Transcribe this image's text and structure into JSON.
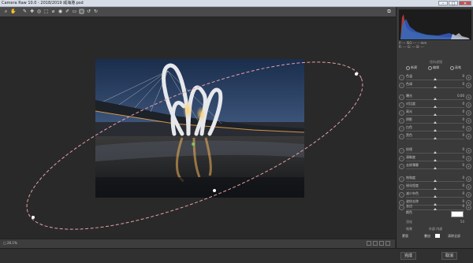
{
  "window": {
    "title": "Camera Raw 10.0 - 2018/2019 威海港.psd",
    "minimize": "–",
    "maximize": "□",
    "close": "✕"
  },
  "toolbar": {
    "tools": [
      "zoom-tool",
      "hand-tool",
      "white-balance-tool",
      "color-sampler-tool",
      "targeted-adjustment-tool",
      "transform-tool",
      "spot-removal-tool",
      "red-eye-tool",
      "adjustment-brush-tool",
      "graduated-filter-tool",
      "radial-filter-tool",
      "rotate-ccw-tool",
      "rotate-cw-tool"
    ],
    "glyphs": [
      "⌕",
      "✋",
      "✎",
      "✚",
      "◎",
      "⬚",
      "⌀",
      "◉",
      "✐",
      "▭",
      "◯",
      "↺",
      "↻"
    ],
    "preview_glyph": "⧉"
  },
  "camera_info": {
    "line1": "f/   ---     ISO ---    -- mm",
    "line2": "R:  ---    G:  ---    B:  ---"
  },
  "mode": {
    "label": "径向滤镜",
    "options": [
      "新建",
      "编辑",
      "画笔"
    ]
  },
  "sliders": [
    {
      "label": "色温",
      "value": "0"
    },
    {
      "label": "色调",
      "value": "0"
    },
    {
      "label": "曝光",
      "value": "0.00"
    },
    {
      "label": "对比度",
      "value": "0"
    },
    {
      "label": "高光",
      "value": "0"
    },
    {
      "label": "阴影",
      "value": "0"
    },
    {
      "label": "白色",
      "value": "0"
    },
    {
      "label": "黑色",
      "value": "0"
    },
    {
      "label": "纹理",
      "value": "0"
    },
    {
      "label": "清晰度",
      "value": "0"
    },
    {
      "label": "去除薄雾",
      "value": "0"
    },
    {
      "label": "饱和度",
      "value": "0"
    },
    {
      "label": "锐化程度",
      "value": "0"
    },
    {
      "label": "减少杂色",
      "value": "0"
    },
    {
      "label": "波纹去除",
      "value": "0"
    },
    {
      "label": "去边",
      "value": "0"
    }
  ],
  "color": {
    "label": "颜色",
    "swatch": "#ffffff"
  },
  "misc": {
    "feather_label": "羽化",
    "feather_value": "50",
    "effect_label": "效果",
    "effect_options": "外部   内部"
  },
  "panel_footer": {
    "mask_label": "蒙版",
    "overlay_label": "叠加",
    "clear_label": "清除全部"
  },
  "bottom": {
    "zoom": "□ 26.1%",
    "mode": "Y"
  },
  "statusbar": {
    "ok": "完成",
    "cancel": "取消"
  },
  "colors": {
    "mask_ellipse": "#e8a0a8",
    "sky_top": "#1d3150",
    "sky_bottom": "#e8b67a",
    "lights": "#ffb340"
  }
}
